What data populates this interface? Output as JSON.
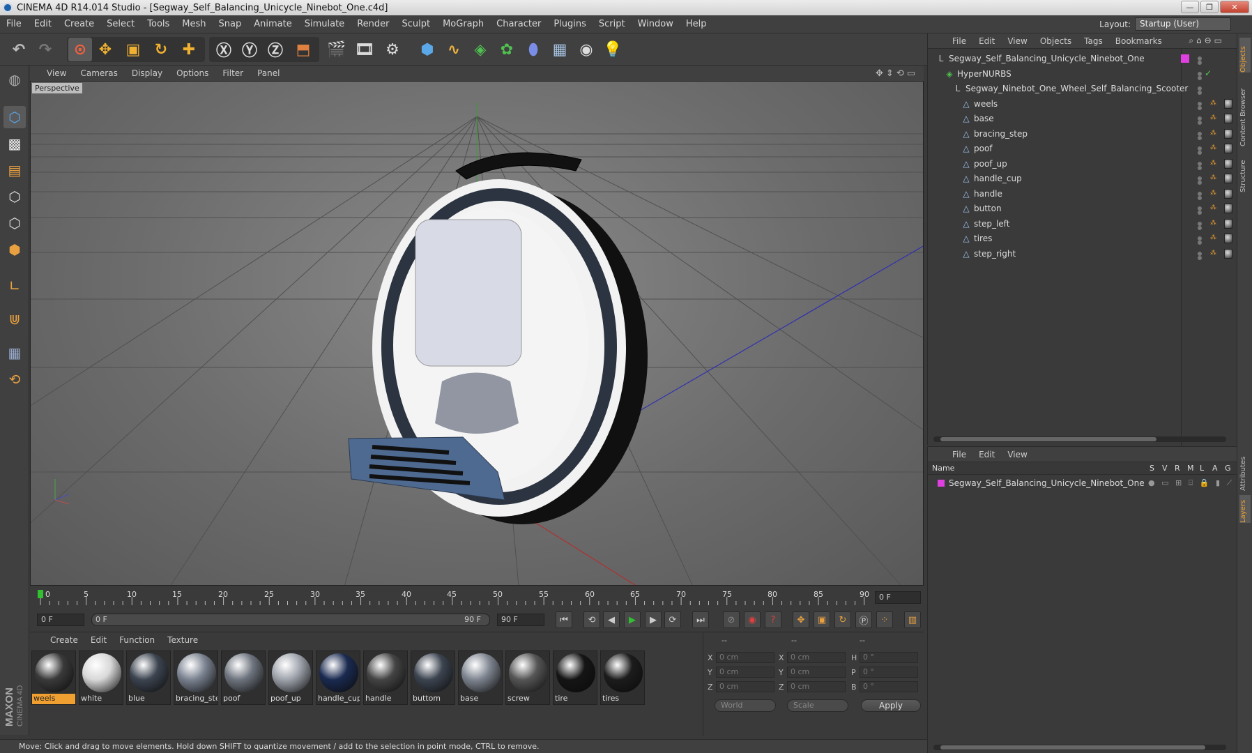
{
  "window": {
    "title": "CINEMA 4D R14.014 Studio - [Segway_Self_Balancing_Unicycle_Ninebot_One.c4d]",
    "buttons": {
      "minimize": "—",
      "maximize": "❐",
      "close": "✕"
    }
  },
  "menu": [
    "File",
    "Edit",
    "Create",
    "Select",
    "Tools",
    "Mesh",
    "Snap",
    "Animate",
    "Simulate",
    "Render",
    "Sculpt",
    "MoGraph",
    "Character",
    "Plugins",
    "Script",
    "Window",
    "Help"
  ],
  "layout": {
    "label": "Layout:",
    "value": "Startup (User)"
  },
  "viewport": {
    "menu": [
      "View",
      "Cameras",
      "Display",
      "Options",
      "Filter",
      "Panel"
    ],
    "label": "Perspective"
  },
  "timeline": {
    "ticks": [
      "0",
      "5",
      "10",
      "15",
      "20",
      "25",
      "30",
      "35",
      "40",
      "45",
      "50",
      "55",
      "60",
      "65",
      "70",
      "75",
      "80",
      "85",
      "90"
    ],
    "current_frame": "0 F",
    "start_field": "0 F",
    "range_start": "0 F",
    "range_end": "90 F",
    "end_field": "90 F"
  },
  "materials": {
    "menu": [
      "Create",
      "Edit",
      "Function",
      "Texture"
    ],
    "items": [
      {
        "name": "weels",
        "selected": true,
        "color": "#3a3a3a"
      },
      {
        "name": "white",
        "selected": false,
        "color": "#d8d8d8"
      },
      {
        "name": "blue",
        "selected": false,
        "color": "#3c4450"
      },
      {
        "name": "bracing_ste",
        "selected": false,
        "color": "#7a8290"
      },
      {
        "name": "poof",
        "selected": false,
        "color": "#6e747e"
      },
      {
        "name": "poof_up",
        "selected": false,
        "color": "#9ea3ac"
      },
      {
        "name": "handle_cup",
        "selected": false,
        "color": "#1a2a50"
      },
      {
        "name": "handle",
        "selected": false,
        "color": "#444"
      },
      {
        "name": "buttom",
        "selected": false,
        "color": "#3c4450"
      },
      {
        "name": "base",
        "selected": false,
        "color": "#7e8590"
      },
      {
        "name": "screw",
        "selected": false,
        "color": "#555"
      },
      {
        "name": "tire",
        "selected": false,
        "color": "#151515"
      },
      {
        "name": "tires",
        "selected": false,
        "color": "#1c1c1c"
      }
    ]
  },
  "coordinates": {
    "header": [
      "--",
      "--",
      "--"
    ],
    "rows": [
      {
        "a": "X",
        "av": "0 cm",
        "b": "X",
        "bv": "0 cm",
        "c": "H",
        "cv": "0 °"
      },
      {
        "a": "Y",
        "av": "0 cm",
        "b": "Y",
        "bv": "0 cm",
        "c": "P",
        "cv": "0 °"
      },
      {
        "a": "Z",
        "av": "0 cm",
        "b": "Z",
        "bv": "0 cm",
        "c": "B",
        "cv": "0 °"
      }
    ],
    "mode": "World",
    "scale": "Scale",
    "apply": "Apply"
  },
  "objects": {
    "menu": [
      "File",
      "Edit",
      "View",
      "Objects",
      "Tags",
      "Bookmarks"
    ],
    "tree": [
      {
        "name": "Segway_Self_Balancing_Unicycle_Ninebot_One",
        "level": 0,
        "icon": "null"
      },
      {
        "name": "HyperNURBS",
        "level": 1,
        "icon": "nurbs"
      },
      {
        "name": "Segway_Ninebot_One_Wheel_Self_Balancing_Scooter",
        "level": 2,
        "icon": "null"
      },
      {
        "name": "weels",
        "level": 3,
        "icon": "poly"
      },
      {
        "name": "base",
        "level": 3,
        "icon": "poly"
      },
      {
        "name": "bracing_step",
        "level": 3,
        "icon": "poly"
      },
      {
        "name": "poof",
        "level": 3,
        "icon": "poly"
      },
      {
        "name": "poof_up",
        "level": 3,
        "icon": "poly"
      },
      {
        "name": "handle_cup",
        "level": 3,
        "icon": "poly"
      },
      {
        "name": "handle",
        "level": 3,
        "icon": "poly"
      },
      {
        "name": "button",
        "level": 3,
        "icon": "poly"
      },
      {
        "name": "step_left",
        "level": 3,
        "icon": "poly"
      },
      {
        "name": "tires",
        "level": 3,
        "icon": "poly"
      },
      {
        "name": "step_right",
        "level": 3,
        "icon": "poly"
      }
    ]
  },
  "layers": {
    "menu": [
      "File",
      "Edit",
      "View"
    ],
    "columns": {
      "name": "Name",
      "flags": [
        "S",
        "V",
        "R",
        "M",
        "L",
        "A",
        "G"
      ]
    },
    "rows": [
      {
        "name": "Segway_Self_Balancing_Unicycle_Ninebot_One",
        "color": "#e040e0"
      }
    ]
  },
  "sidetabs": [
    "Objects",
    "Content Browser",
    "Structure",
    "Attributes",
    "Layers"
  ],
  "status": "Move: Click and drag to move elements. Hold down SHIFT to quantize movement / add to the selection in point mode, CTRL to remove.",
  "maxon": {
    "line1": "MAXON",
    "line2": "CINEMA 4D"
  }
}
